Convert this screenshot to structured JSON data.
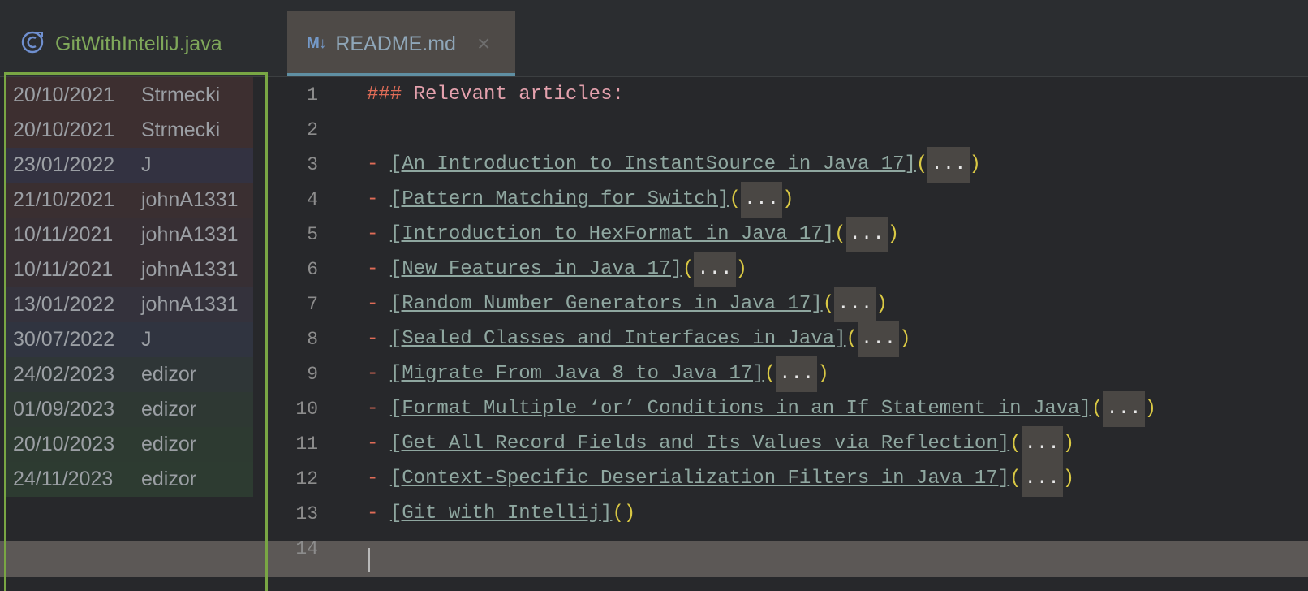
{
  "tabs": [
    {
      "label": "GitWithIntelliJ.java",
      "icon": "java-class-icon",
      "active": false
    },
    {
      "label": "README.md",
      "icon": "markdown-icon",
      "icon_text": "M↓",
      "active": true,
      "close_glyph": "×"
    }
  ],
  "annotations": [
    {
      "date": "20/10/2021",
      "author": "Strmecki",
      "color": "#3d2f30"
    },
    {
      "date": "20/10/2021",
      "author": "Strmecki",
      "color": "#3d2f30"
    },
    {
      "date": "23/01/2022",
      "author": "J",
      "color": "#333241"
    },
    {
      "date": "21/10/2021",
      "author": "johnA1331",
      "color": "#3a2f31"
    },
    {
      "date": "10/11/2021",
      "author": "johnA1331",
      "color": "#372f34"
    },
    {
      "date": "10/11/2021",
      "author": "johnA1331",
      "color": "#372f34"
    },
    {
      "date": "13/01/2022",
      "author": "johnA1331",
      "color": "#34323c"
    },
    {
      "date": "30/07/2022",
      "author": "J",
      "color": "#303440"
    },
    {
      "date": "24/02/2023",
      "author": "edizor",
      "color": "#2f3637"
    },
    {
      "date": "01/09/2023",
      "author": "edizor",
      "color": "#2e3833"
    },
    {
      "date": "20/10/2023",
      "author": "edizor",
      "color": "#2d3a31"
    },
    {
      "date": "24/11/2023",
      "author": "edizor",
      "color": "#2d3b31"
    }
  ],
  "line_numbers": [
    "1",
    "2",
    "3",
    "4",
    "5",
    "6",
    "7",
    "8",
    "9",
    "10",
    "11",
    "12",
    "13",
    "14"
  ],
  "code": {
    "header_mark": "###",
    "header_text": "Relevant articles:",
    "bullet": "-",
    "ellipsis": "...",
    "links": [
      "[An Introduction to InstantSource in Java 17]",
      "[Pattern Matching for Switch]",
      "[Introduction to HexFormat in Java 17]",
      "[New Features in Java 17]",
      "[Random Number Generators in Java 17]",
      "[Sealed Classes and Interfaces in Java]",
      "[Migrate From Java 8 to Java 17]",
      "[Format Multiple ‘or’ Conditions in an If Statement in Java]",
      "[Get All Record Fields and Its Values via Reflection]",
      "[Context-Specific Deserialization Filters in Java 17]",
      "[Git with Intellij]"
    ]
  },
  "colors": {
    "annotation_frame": "#79a644",
    "current_line": "#5c5856"
  }
}
